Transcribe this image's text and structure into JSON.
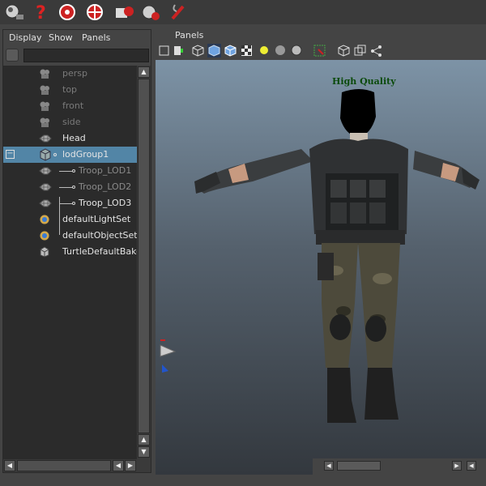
{
  "outliner": {
    "menu": [
      "Display",
      "Show",
      "Panels"
    ],
    "search_placeholder": "",
    "items": [
      {
        "label": "persp",
        "icon": "camera-icon",
        "state": "dim"
      },
      {
        "label": "top",
        "icon": "camera-icon",
        "state": "dim"
      },
      {
        "label": "front",
        "icon": "camera-icon",
        "state": "dim"
      },
      {
        "label": "side",
        "icon": "camera-icon",
        "state": "dim"
      },
      {
        "label": "Head",
        "icon": "mesh-icon",
        "state": "normal"
      },
      {
        "label": "lodGroup1",
        "icon": "lod-group-icon",
        "state": "selected"
      },
      {
        "label": "Troop_LOD1",
        "icon": "mesh-icon",
        "state": "lod"
      },
      {
        "label": "Troop_LOD2",
        "icon": "mesh-icon",
        "state": "lod"
      },
      {
        "label": "Troop_LOD3",
        "icon": "mesh-icon",
        "state": "normal"
      },
      {
        "label": "defaultLightSet",
        "icon": "set-icon",
        "state": "normal"
      },
      {
        "label": "defaultObjectSet",
        "icon": "set-icon",
        "state": "normal"
      },
      {
        "label": "TurtleDefaultBakeLa",
        "icon": "bake-layer-icon",
        "state": "normal"
      }
    ]
  },
  "viewport": {
    "menu_label": "Panels",
    "overlay_label": "High Quality"
  },
  "colors": {
    "selection": "#5285a6",
    "overlay_text": "#0a4a0a",
    "outliner_bg": "#2b2b2b"
  }
}
